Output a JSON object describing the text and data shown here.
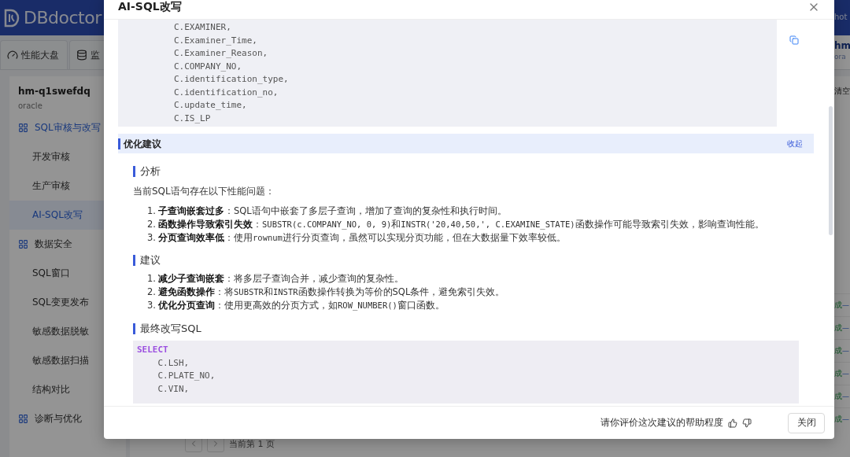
{
  "app": {
    "logo": "DBdoctor",
    "header_right": "hot",
    "tabs": [
      {
        "label": "性能大盘",
        "kind": "gauge"
      },
      {
        "label": "监",
        "kind": "database"
      }
    ],
    "account": {
      "name": "hm",
      "type": "ora"
    },
    "instance": {
      "name": "hm-q1swefdq",
      "type": "oracle"
    },
    "sidebar": [
      {
        "label": "SQL审核与改写",
        "active": true,
        "children": [
          {
            "label": "开发审核",
            "selected": false
          },
          {
            "label": "生产审核",
            "selected": false
          },
          {
            "label": "AI-SQL改写",
            "selected": true
          }
        ]
      },
      {
        "label": "数据安全",
        "active": false,
        "children": [
          {
            "label": "SQL窗口",
            "selected": false
          },
          {
            "label": "SQL变更发布",
            "selected": false
          },
          {
            "label": "敏感数据脱敏",
            "selected": false
          },
          {
            "label": "敏感数据扫描",
            "selected": false
          },
          {
            "label": "结构对比",
            "selected": false
          }
        ]
      },
      {
        "label": "诊断与优化",
        "active": false
      }
    ],
    "toolbar_action": "清空",
    "status_rows": [
      {
        "status": "成",
        "value": "—"
      },
      {
        "status": "成",
        "value": "—"
      },
      {
        "status": "成",
        "value": "—"
      },
      {
        "status": "成",
        "value": "—"
      },
      {
        "status": "成",
        "value": "—"
      },
      {
        "status": "成",
        "value": "—"
      }
    ],
    "pagination": "当前第 1 页"
  },
  "dialog": {
    "title": "AI-SQL改写",
    "source_code": [
      "        C.EXAMINER,",
      "        C.Examiner_Time,",
      "        C.Examiner_Reason,",
      "        C.COMPANY_NO,",
      "        C.identification_type,",
      "        C.identification_no,",
      "        C.update_time,",
      "        C.IS_LP"
    ],
    "section": {
      "title": "优化建议",
      "toggle": "收起"
    },
    "blocks": [
      {
        "kind": "heading",
        "text": "分析"
      },
      {
        "kind": "paragraph",
        "text": "当前SQL语句存在以下性能问题："
      },
      {
        "kind": "list",
        "items": [
          {
            "number": "1.",
            "parts": [
              {
                "kind": "bold",
                "text": "子查询嵌套过多"
              },
              {
                "kind": "text",
                "text": "：SQL语句中嵌套了多层子查询，增加了查询的复杂性和执行时间。"
              }
            ]
          },
          {
            "number": "2.",
            "parts": [
              {
                "kind": "bold",
                "text": "函数操作导致索引失效"
              },
              {
                "kind": "text",
                "text": "："
              },
              {
                "kind": "code",
                "text": "SUBSTR(c.COMPANY_NO, 0, 9)"
              },
              {
                "kind": "text",
                "text": "和"
              },
              {
                "kind": "code",
                "text": "INSTR('20,40,50,', C.EXAMINE_STATE)"
              },
              {
                "kind": "text",
                "text": "函数操作可能导致索引失效，影响查询性能。"
              }
            ]
          },
          {
            "number": "3.",
            "parts": [
              {
                "kind": "bold",
                "text": "分页查询效率低"
              },
              {
                "kind": "text",
                "text": "：使用"
              },
              {
                "kind": "code",
                "text": "rownum"
              },
              {
                "kind": "text",
                "text": "进行分页查询，虽然可以实现分页功能，但在大数据量下效率较低。"
              }
            ]
          }
        ]
      },
      {
        "kind": "heading",
        "text": "建议"
      },
      {
        "kind": "list",
        "items": [
          {
            "number": "1.",
            "parts": [
              {
                "kind": "bold",
                "text": "减少子查询嵌套"
              },
              {
                "kind": "text",
                "text": "：将多层子查询合并，减少查询的复杂性。"
              }
            ]
          },
          {
            "number": "2.",
            "parts": [
              {
                "kind": "bold",
                "text": "避免函数操作"
              },
              {
                "kind": "text",
                "text": "：将"
              },
              {
                "kind": "code",
                "text": "SUBSTR"
              },
              {
                "kind": "text",
                "text": "和"
              },
              {
                "kind": "code",
                "text": "INSTR"
              },
              {
                "kind": "text",
                "text": "函数操作转换为等价的SQL条件，避免索引失效。"
              }
            ]
          },
          {
            "number": "3.",
            "parts": [
              {
                "kind": "bold",
                "text": "优化分页查询"
              },
              {
                "kind": "text",
                "text": "：使用更高效的分页方式，如"
              },
              {
                "kind": "code",
                "text": "ROW_NUMBER()"
              },
              {
                "kind": "text",
                "text": "窗口函数。"
              }
            ]
          }
        ]
      },
      {
        "kind": "heading",
        "text": "最终改写SQL"
      },
      {
        "kind": "code",
        "lines": [
          {
            "kind": "keyword",
            "text": "SELECT"
          },
          {
            "kind": "plain",
            "text": "    C.LSH,"
          },
          {
            "kind": "plain",
            "text": "    C.PLATE_NO,"
          },
          {
            "kind": "plain",
            "text": "    C.VIN,"
          }
        ]
      }
    ],
    "feedback": {
      "prompt": "请你评价这次建议的帮助程度"
    },
    "close_button": "关闭"
  }
}
